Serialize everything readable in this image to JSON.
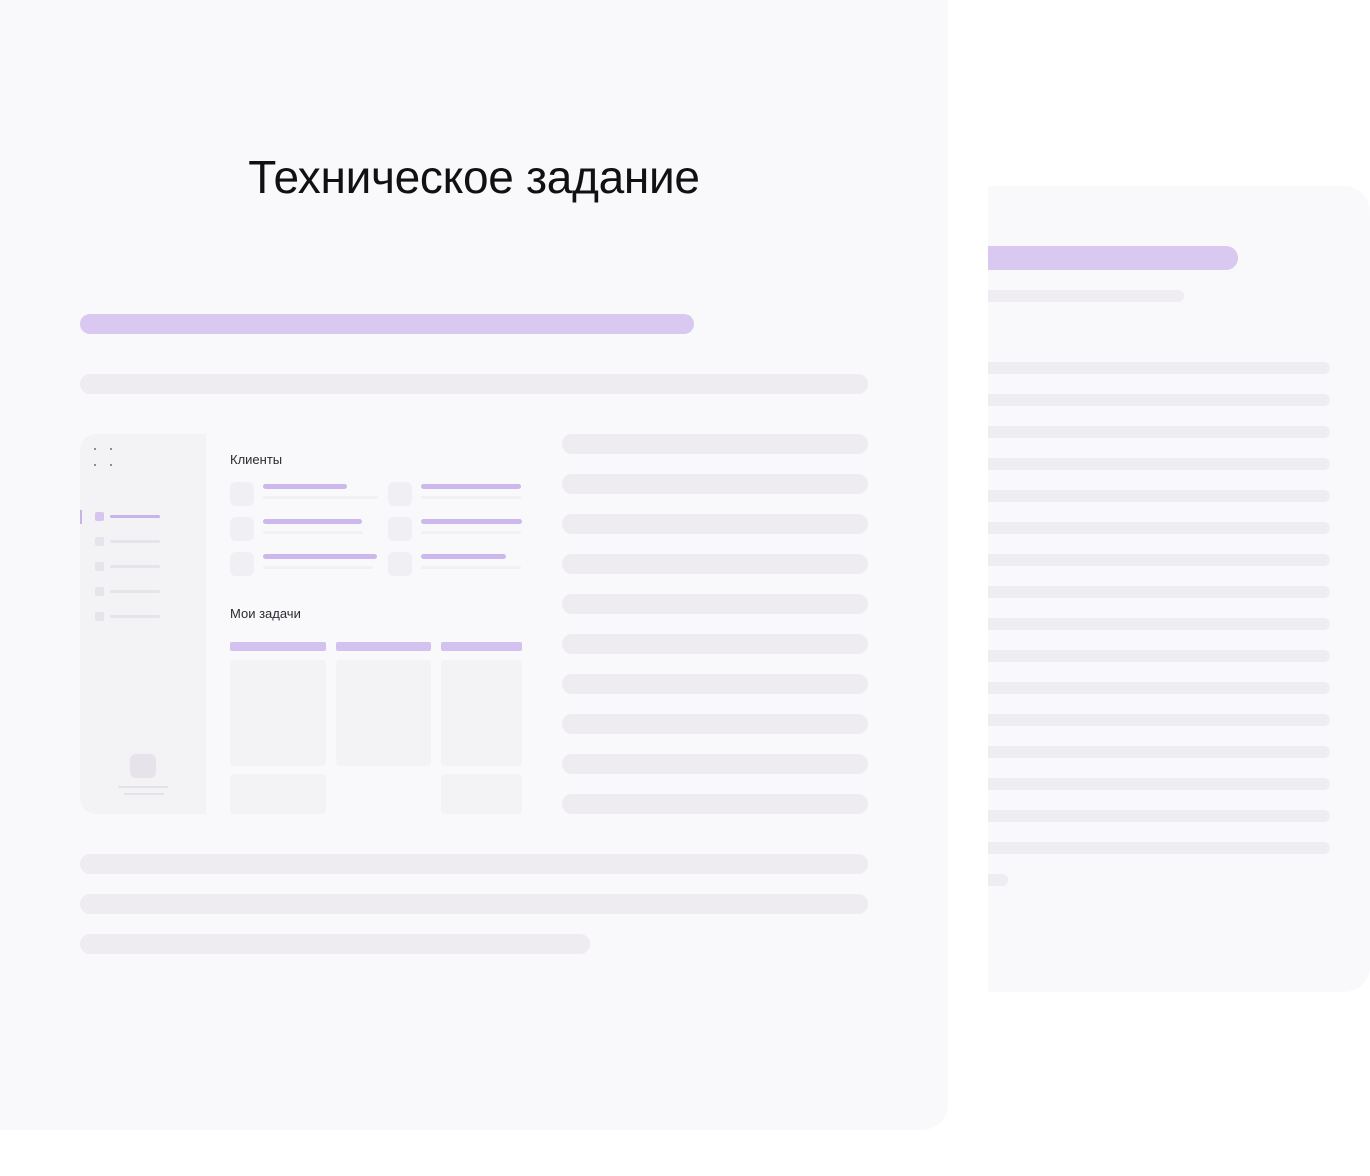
{
  "document": {
    "title": "Техническое задание"
  },
  "preview": {
    "clients_label": "Клиенты",
    "tasks_label": "Мои задачи"
  },
  "colors": {
    "accent_bar": "#d9c8ef",
    "placeholder_bar": "#eeebf1",
    "page_background": "#f9f8fb"
  }
}
